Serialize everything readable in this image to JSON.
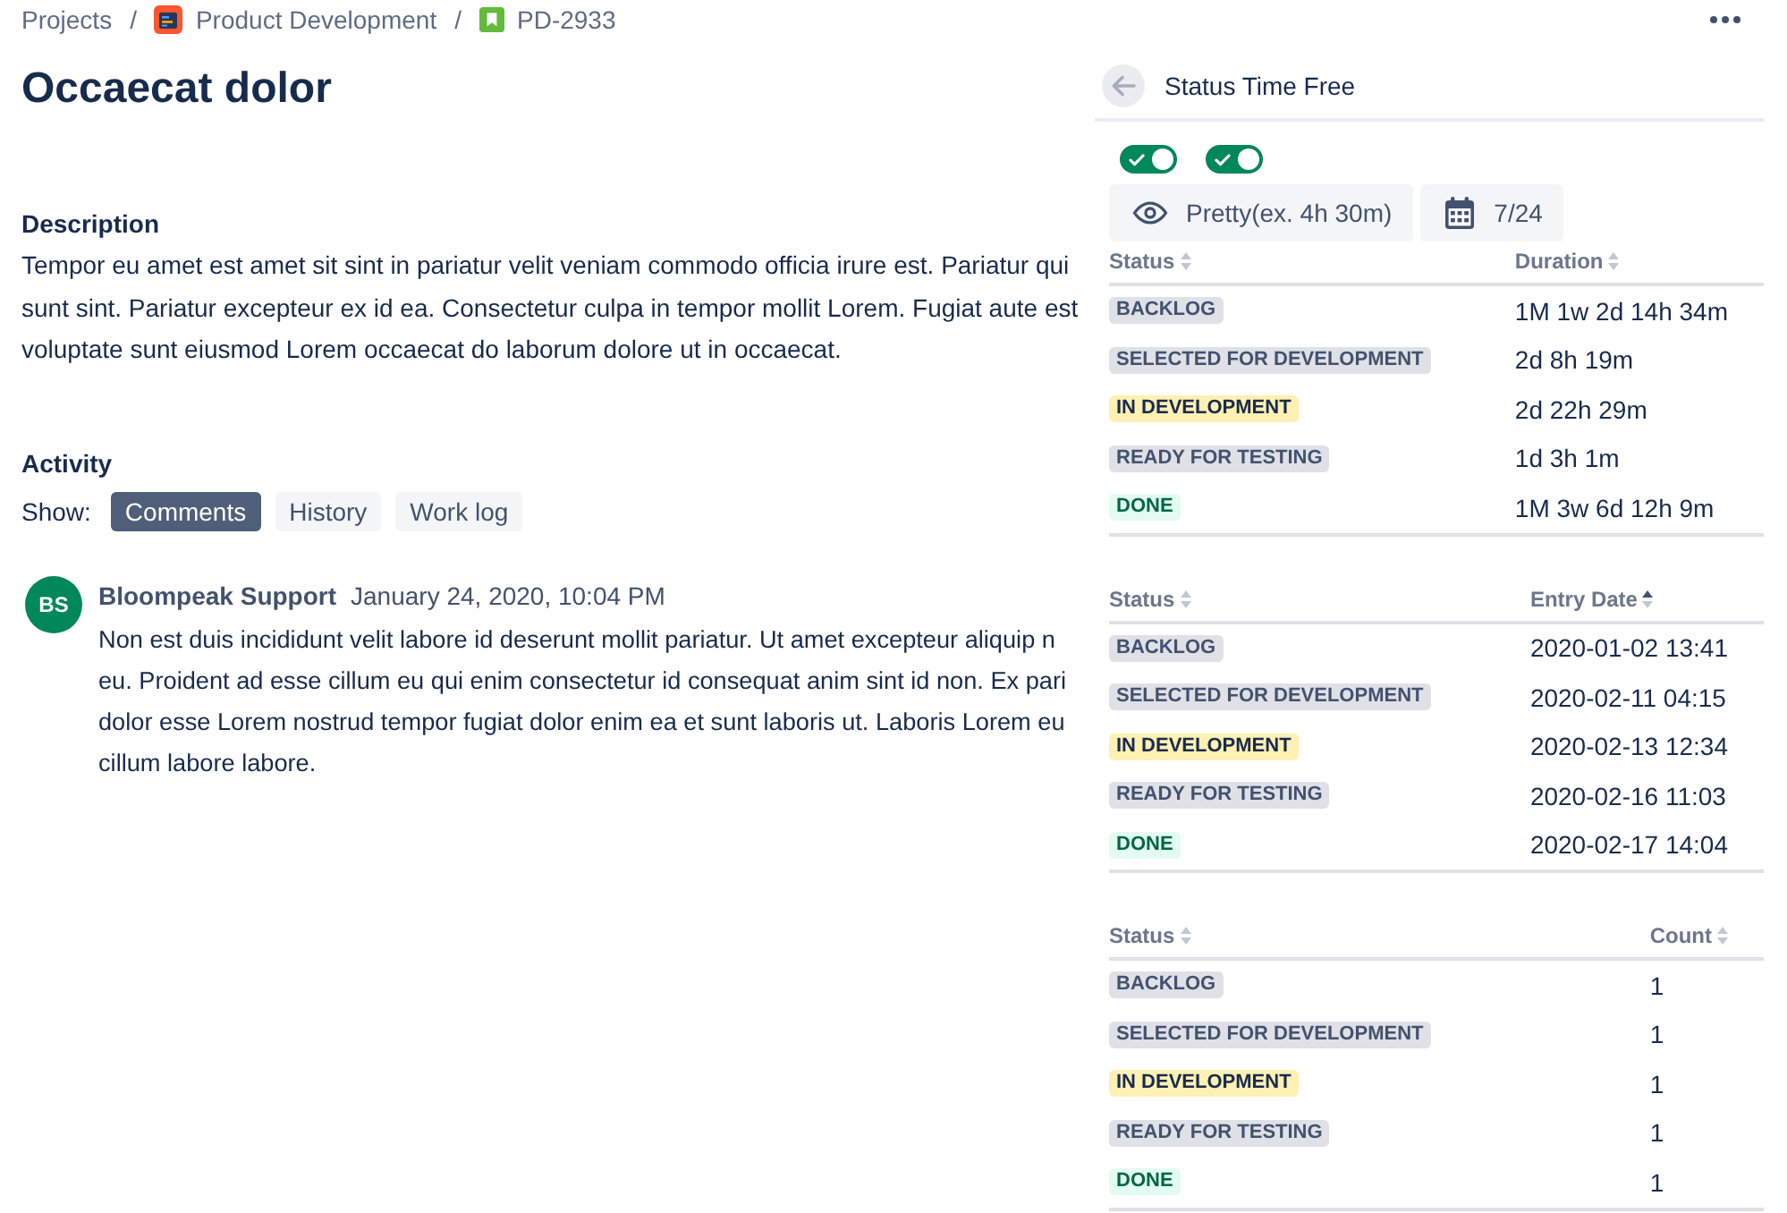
{
  "breadcrumbs": [
    {
      "kind": "link",
      "label": "Projects"
    },
    {
      "kind": "separator",
      "label": "/"
    },
    {
      "kind": "project",
      "label": "Product Development"
    },
    {
      "kind": "separator",
      "label": "/"
    },
    {
      "kind": "issue",
      "label": "PD-2933"
    }
  ],
  "issue": {
    "title": "Occaecat dolor",
    "description_heading": "Description",
    "description": "Tempor eu amet est amet sit sint in pariatur velit veniam commodo officia irure est. Pariatur qui sunt sint. Pariatur excepteur ex id ea. Consectetur culpa in tempor mollit Lorem. Fugiat aute est voluptate sunt eiusmod Lorem occaecat do laborum dolore ut in occaecat."
  },
  "activity": {
    "heading": "Activity",
    "show_label": "Show:",
    "tabs": [
      {
        "label": "Comments",
        "selected": true
      },
      {
        "label": "History",
        "selected": false
      },
      {
        "label": "Work log",
        "selected": false
      }
    ],
    "comment": {
      "initials": "BS",
      "author": "Bloompeak Support",
      "date": "January 24, 2020, 10:04 PM",
      "body_lines": [
        "Non est duis incididunt velit labore id deserunt mollit pariatur. Ut amet excepteur aliquip n",
        "eu. Proident ad esse cillum eu qui enim consectetur id consequat anim sint id non. Ex pari",
        "dolor esse Lorem nostrud tempor fugiat dolor enim ea et sunt laboris ut. Laboris Lorem eu",
        "cillum labore labore."
      ]
    }
  },
  "panel": {
    "title": "Status Time Free",
    "toggles": [
      {
        "on": true
      },
      {
        "on": true
      }
    ],
    "buttons": [
      {
        "kind": "format",
        "label": "Pretty(ex. 4h 30m)"
      },
      {
        "kind": "calendar",
        "label": "7/24"
      }
    ],
    "tables": [
      {
        "columns": [
          {
            "label": "Status",
            "sorted": false
          },
          {
            "label": "Duration",
            "sorted": false
          }
        ],
        "rows": [
          {
            "status": "BACKLOG",
            "color": "#dfe1e6",
            "value": "1M 1w 2d 14h 34m"
          },
          {
            "status": "SELECTED FOR DEVELOPMENT",
            "color": "#dfe1e6",
            "value": "2d 8h 19m"
          },
          {
            "status": "IN DEVELOPMENT",
            "color": "#fff0b3",
            "value": "2d 22h 29m"
          },
          {
            "status": "READY FOR TESTING",
            "color": "#dfe1e6",
            "value": "1d 3h 1m"
          },
          {
            "status": "DONE",
            "color": "#e3fcef",
            "value": "1M 3w 6d 12h 9m"
          }
        ]
      },
      {
        "columns": [
          {
            "label": "Status",
            "sorted": false
          },
          {
            "label": "Entry Date",
            "sorted": true
          }
        ],
        "rows": [
          {
            "status": "BACKLOG",
            "color": "#dfe1e6",
            "value": "2020-01-02 13:41"
          },
          {
            "status": "SELECTED FOR DEVELOPMENT",
            "color": "#dfe1e6",
            "value": "2020-02-11 04:15"
          },
          {
            "status": "IN DEVELOPMENT",
            "color": "#fff0b3",
            "value": "2020-02-13 12:34"
          },
          {
            "status": "READY FOR TESTING",
            "color": "#dfe1e6",
            "value": "2020-02-16 11:03"
          },
          {
            "status": "DONE",
            "color": "#e3fcef",
            "value": "2020-02-17 14:04"
          }
        ]
      },
      {
        "columns": [
          {
            "label": "Status",
            "sorted": false
          },
          {
            "label": "Count",
            "sorted": false
          }
        ],
        "rows": [
          {
            "status": "BACKLOG",
            "color": "#dfe1e6",
            "value": "1"
          },
          {
            "status": "SELECTED FOR DEVELOPMENT",
            "color": "#dfe1e6",
            "value": "1"
          },
          {
            "status": "IN DEVELOPMENT",
            "color": "#fff0b3",
            "value": "1"
          },
          {
            "status": "READY FOR TESTING",
            "color": "#dfe1e6",
            "value": "1"
          },
          {
            "status": "DONE",
            "color": "#e3fcef",
            "value": "1"
          }
        ]
      }
    ]
  }
}
